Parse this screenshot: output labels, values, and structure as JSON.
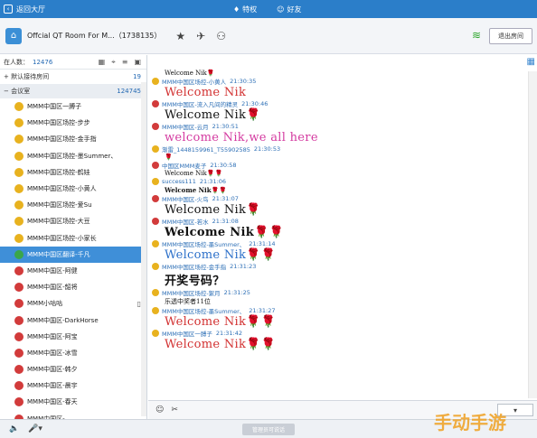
{
  "topbar": {
    "back_label": "返回大厅",
    "privilege_label": "特权",
    "friends_label": "好友",
    "window_icons": [
      "⚲",
      "♫",
      "□",
      "－",
      "✕"
    ]
  },
  "room": {
    "title": "Offcial QT Room For M...（1738135）",
    "exit_label": "退出房间"
  },
  "left": {
    "online_label": "在人数：",
    "online_count": "12476",
    "groups": [
      {
        "label": "默认接待房间",
        "count": "19"
      },
      {
        "label": "会议室",
        "count": "124745"
      }
    ],
    "users": [
      {
        "name": "MMM中国区一膊子",
        "color": "y"
      },
      {
        "name": "MMM中国区场控-步步",
        "color": "y"
      },
      {
        "name": "MMM中国区场控-金手指",
        "color": "y"
      },
      {
        "name": "MMM中国区场控-墨Summer、",
        "color": "y"
      },
      {
        "name": "MMM中国区场控-鹤娃",
        "color": "y"
      },
      {
        "name": "MMM中国区场控-小黄人",
        "color": "y"
      },
      {
        "name": "MMM中国区场控-爱Su",
        "color": "y"
      },
      {
        "name": "MMM中国区场控-大豆",
        "color": "y"
      },
      {
        "name": "MMM中国区场控-小家长",
        "color": "y"
      },
      {
        "name": "MMM中国区翻译-千凡",
        "color": "g"
      },
      {
        "name": "MMM中国区-阿健",
        "color": "r"
      },
      {
        "name": "MMM中国区-韶将",
        "color": "r"
      },
      {
        "name": "MMM小咕咕",
        "color": "r"
      },
      {
        "name": "MMM中国区-DarkHorse",
        "color": "r"
      },
      {
        "name": "MMM中国区-阿宝",
        "color": "r"
      },
      {
        "name": "MMM中国区-冰雪",
        "color": "r"
      },
      {
        "name": "MMM中国区-韩夕",
        "color": "r"
      },
      {
        "name": "MMM中国区-晨宇",
        "color": "r"
      },
      {
        "name": "MMM中国区-春天",
        "color": "r"
      },
      {
        "name": "MMM中国区-……",
        "color": "r"
      }
    ]
  },
  "messages": [
    {
      "sender": "",
      "time": "",
      "text": "Welcome Nik🌹",
      "cls": "s-sm c-blk",
      "av": ""
    },
    {
      "sender": "MMM中国区场控-小黄人",
      "time": "21:30:35",
      "text": "Welcome Nik",
      "cls": "s-big c-red",
      "av": "y"
    },
    {
      "sender": "MMM中国区-流入凡间的精灵",
      "time": "21:30:46",
      "text": "Welcome Nik🌹",
      "cls": "s-big c-blk",
      "av": "r"
    },
    {
      "sender": "MMM中国区-云月",
      "time": "21:30:51",
      "text": "welcome Nik,we all here",
      "cls": "s-big c-pink",
      "av": "r"
    },
    {
      "sender": "渐雷_1448159961_T55902585",
      "time": "21:30:53",
      "text": "🌹",
      "cls": "s-sm c-red",
      "av": "y"
    },
    {
      "sender": "中国区MMM麦子",
      "time": "21:30:58",
      "text": "Welcome Nik🌹🌹",
      "cls": "s-sm c-blk",
      "av": "r"
    },
    {
      "sender": "success111",
      "time": "21:31:06",
      "text": "Welcome Nik🌹🌹",
      "cls": "s-sm c-blk bold",
      "av": "y"
    },
    {
      "sender": "MMM中国区-火鸟",
      "time": "21:31:07",
      "text": "Welcome Nik🌹",
      "cls": "s-big c-blk",
      "av": "r"
    },
    {
      "sender": "MMM中国区-若水",
      "time": "21:31:08",
      "text": "Welcome Nik🌹🌹",
      "cls": "s-big c-blk bold",
      "av": "r"
    },
    {
      "sender": "MMM中国区场控-墨Summer、",
      "time": "21:31:14",
      "text": "Welcome Nik🌹🌹",
      "cls": "s-big c-blue",
      "av": "y"
    },
    {
      "sender": "MMM中国区场控-金手指",
      "time": "21:31:23",
      "text": "开奖号码？",
      "cls": "s-big c-blk bold",
      "av": "y"
    },
    {
      "sender": "MMM中国区场控-絮月",
      "time": "21:31:25",
      "text": "乐透中奖者11位",
      "cls": "s-sm c-blk",
      "av": "y"
    },
    {
      "sender": "MMM中国区场控-墨Summer、",
      "time": "21:31:27",
      "text": "Welcome Nik🌹🌹",
      "cls": "s-big c-red",
      "av": "y"
    },
    {
      "sender": "MMM中国区一膊子",
      "time": "21:31:42",
      "text": "Welcome Nik🌹🌹",
      "cls": "s-big c-red",
      "av": "y"
    }
  ],
  "bottom": {
    "manage_label": "管理员可说话"
  },
  "watermark": "手动手游"
}
